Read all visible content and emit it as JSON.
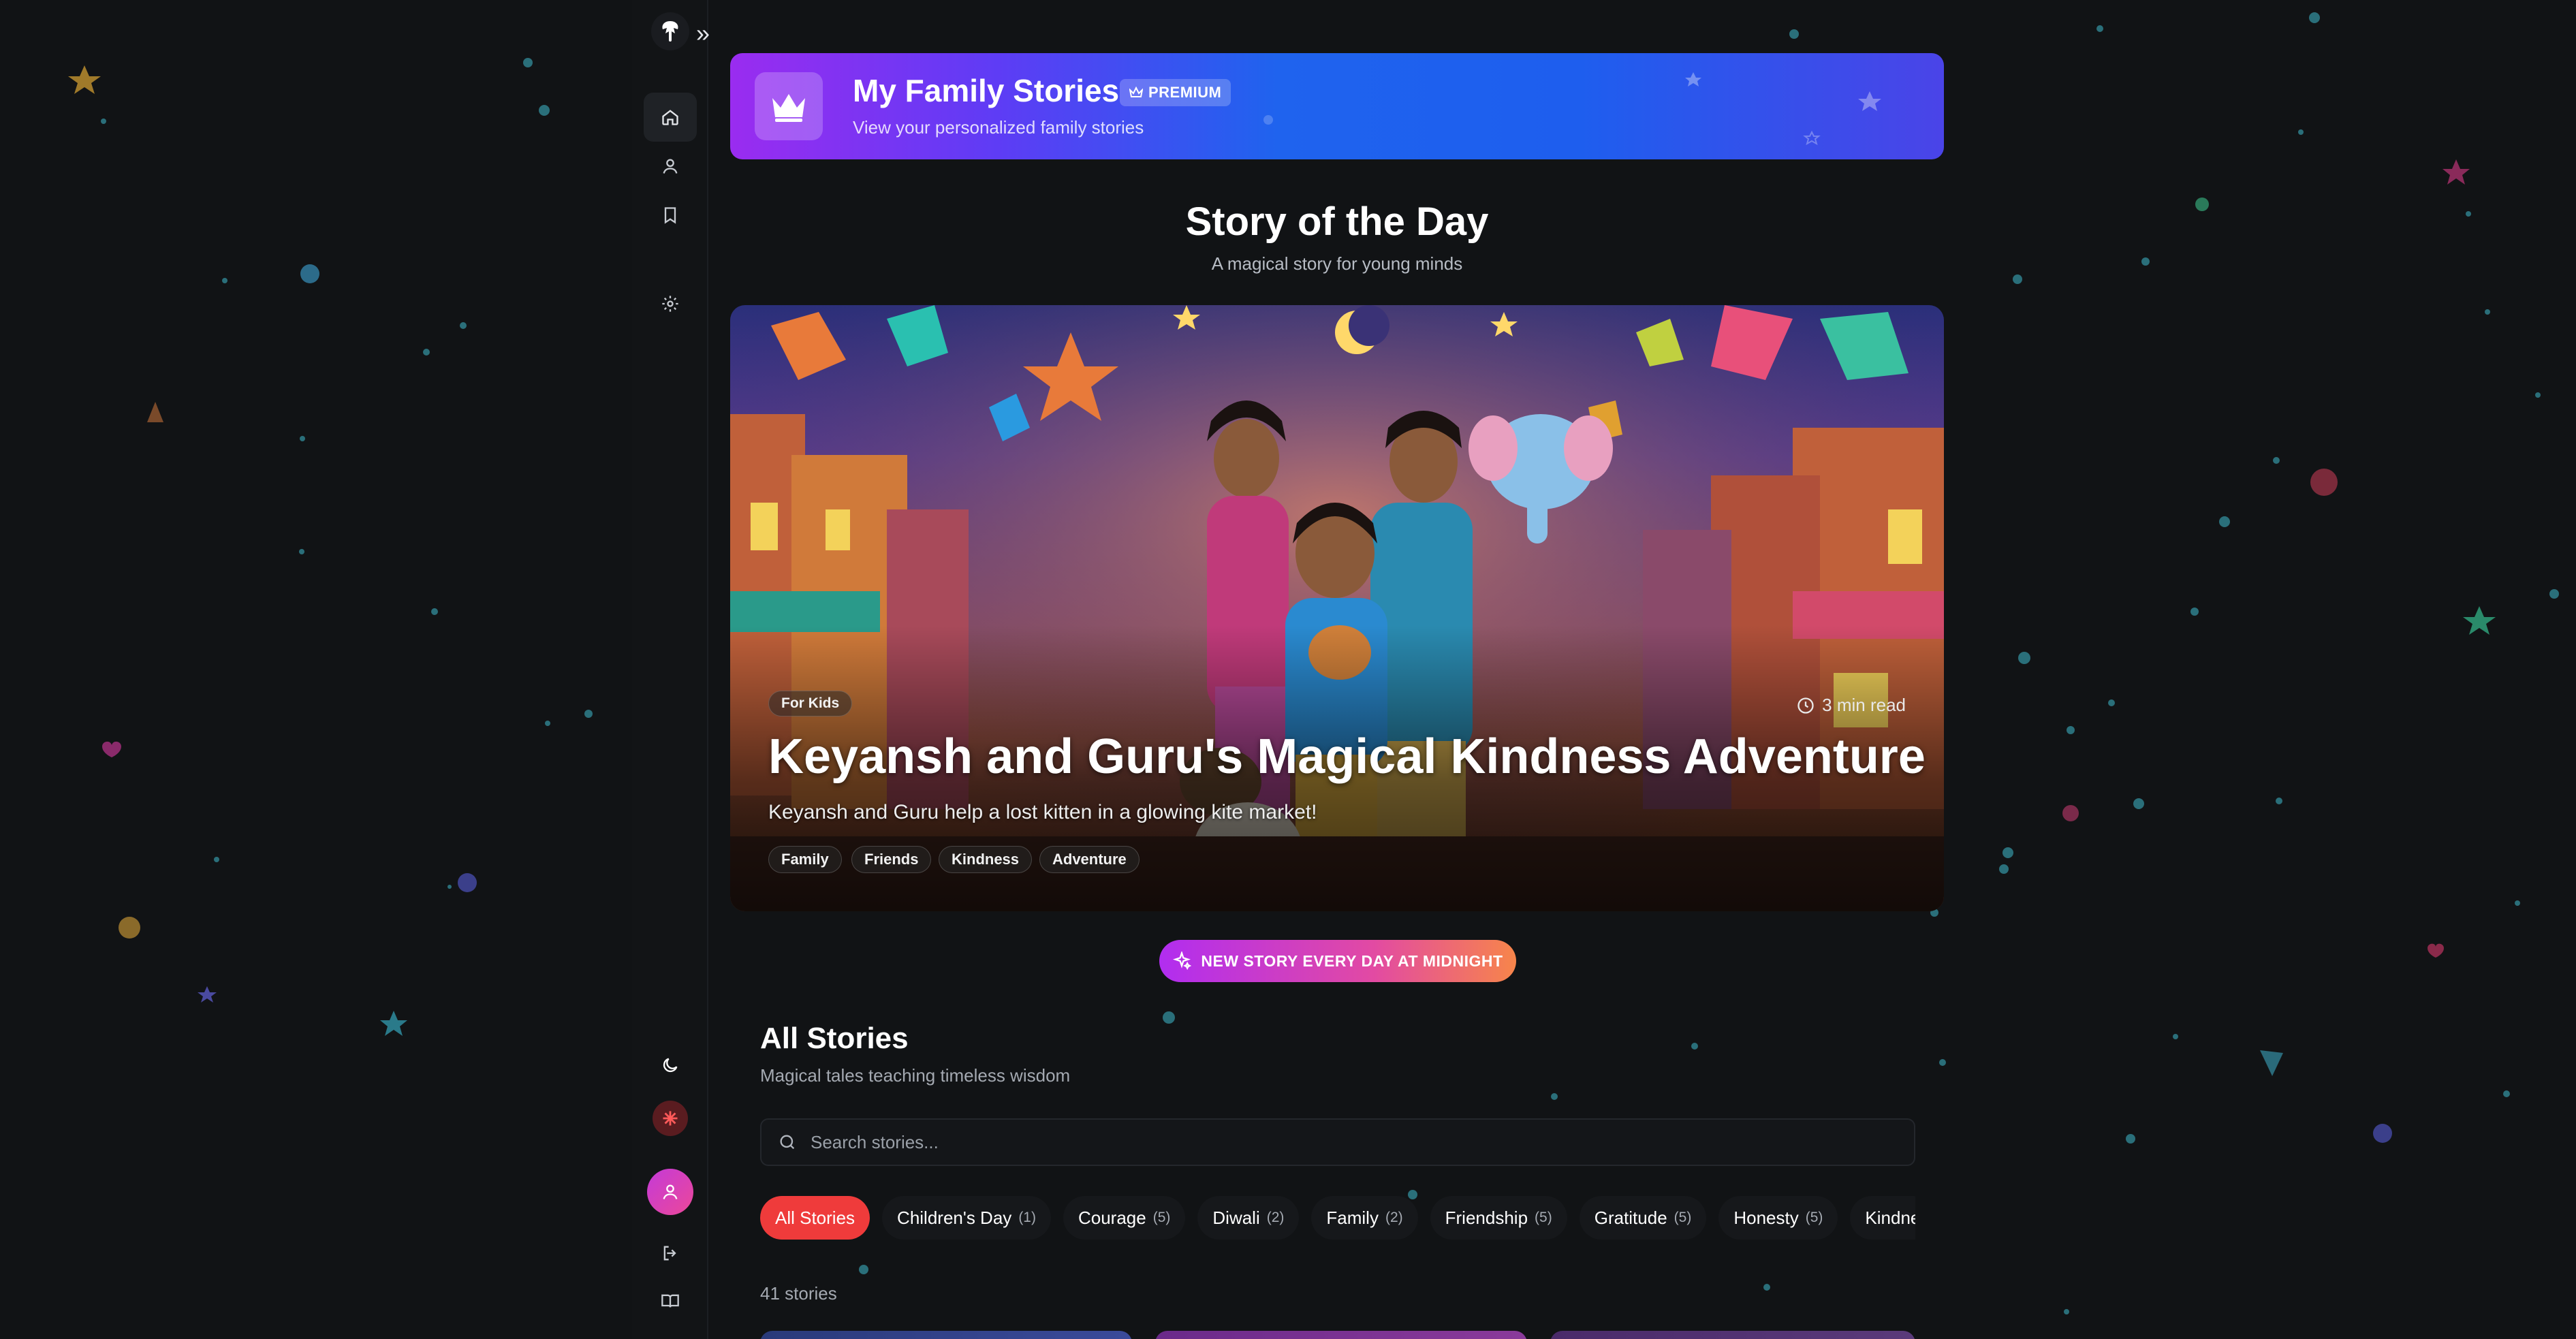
{
  "sidebar": {
    "nav": [
      {
        "name": "home",
        "icon": "home-icon",
        "active": true
      },
      {
        "name": "profile",
        "icon": "user-icon",
        "active": false
      },
      {
        "name": "bookmarks",
        "icon": "bookmark-icon",
        "active": false
      },
      {
        "name": "settings",
        "icon": "gear-icon",
        "active": false
      }
    ],
    "bottom": [
      "moon-icon",
      "asterisk-icon",
      "avatar",
      "logout-icon",
      "book-icon"
    ],
    "expand_glyph": "»"
  },
  "banner": {
    "title": "My Family Stories",
    "premium_label": "PREMIUM",
    "subtitle": "View your personalized family stories"
  },
  "story_of_day": {
    "heading": "Story of the Day",
    "subheading": "A magical story for young minds",
    "category": "For Kids",
    "read_time": "3 min read",
    "title": "Keyansh and Guru's Magical Kindness Adventure",
    "description": "Keyansh and Guru help a lost kitten in a glowing kite market!",
    "tags": [
      "Family",
      "Friends",
      "Kindness",
      "Adventure"
    ]
  },
  "new_story_badge": "NEW STORY EVERY DAY AT MIDNIGHT",
  "all_stories": {
    "title": "All Stories",
    "subtitle": "Magical tales teaching timeless wisdom",
    "search_placeholder": "Search stories...",
    "filters": [
      {
        "label": "All Stories",
        "count": "",
        "active": true
      },
      {
        "label": "Children's Day",
        "count": "(1)"
      },
      {
        "label": "Courage",
        "count": "(5)"
      },
      {
        "label": "Diwali",
        "count": "(2)"
      },
      {
        "label": "Family",
        "count": "(2)"
      },
      {
        "label": "Friendship",
        "count": "(5)"
      },
      {
        "label": "Gratitude",
        "count": "(5)"
      },
      {
        "label": "Honesty",
        "count": "(5)"
      },
      {
        "label": "Kindne",
        "count": ""
      }
    ],
    "count_text": "41 stories"
  },
  "colors": {
    "background": "#111315",
    "accent_red": "#ef3b3b",
    "banner_start": "#9a2cf0",
    "banner_end": "#4a44e8"
  }
}
